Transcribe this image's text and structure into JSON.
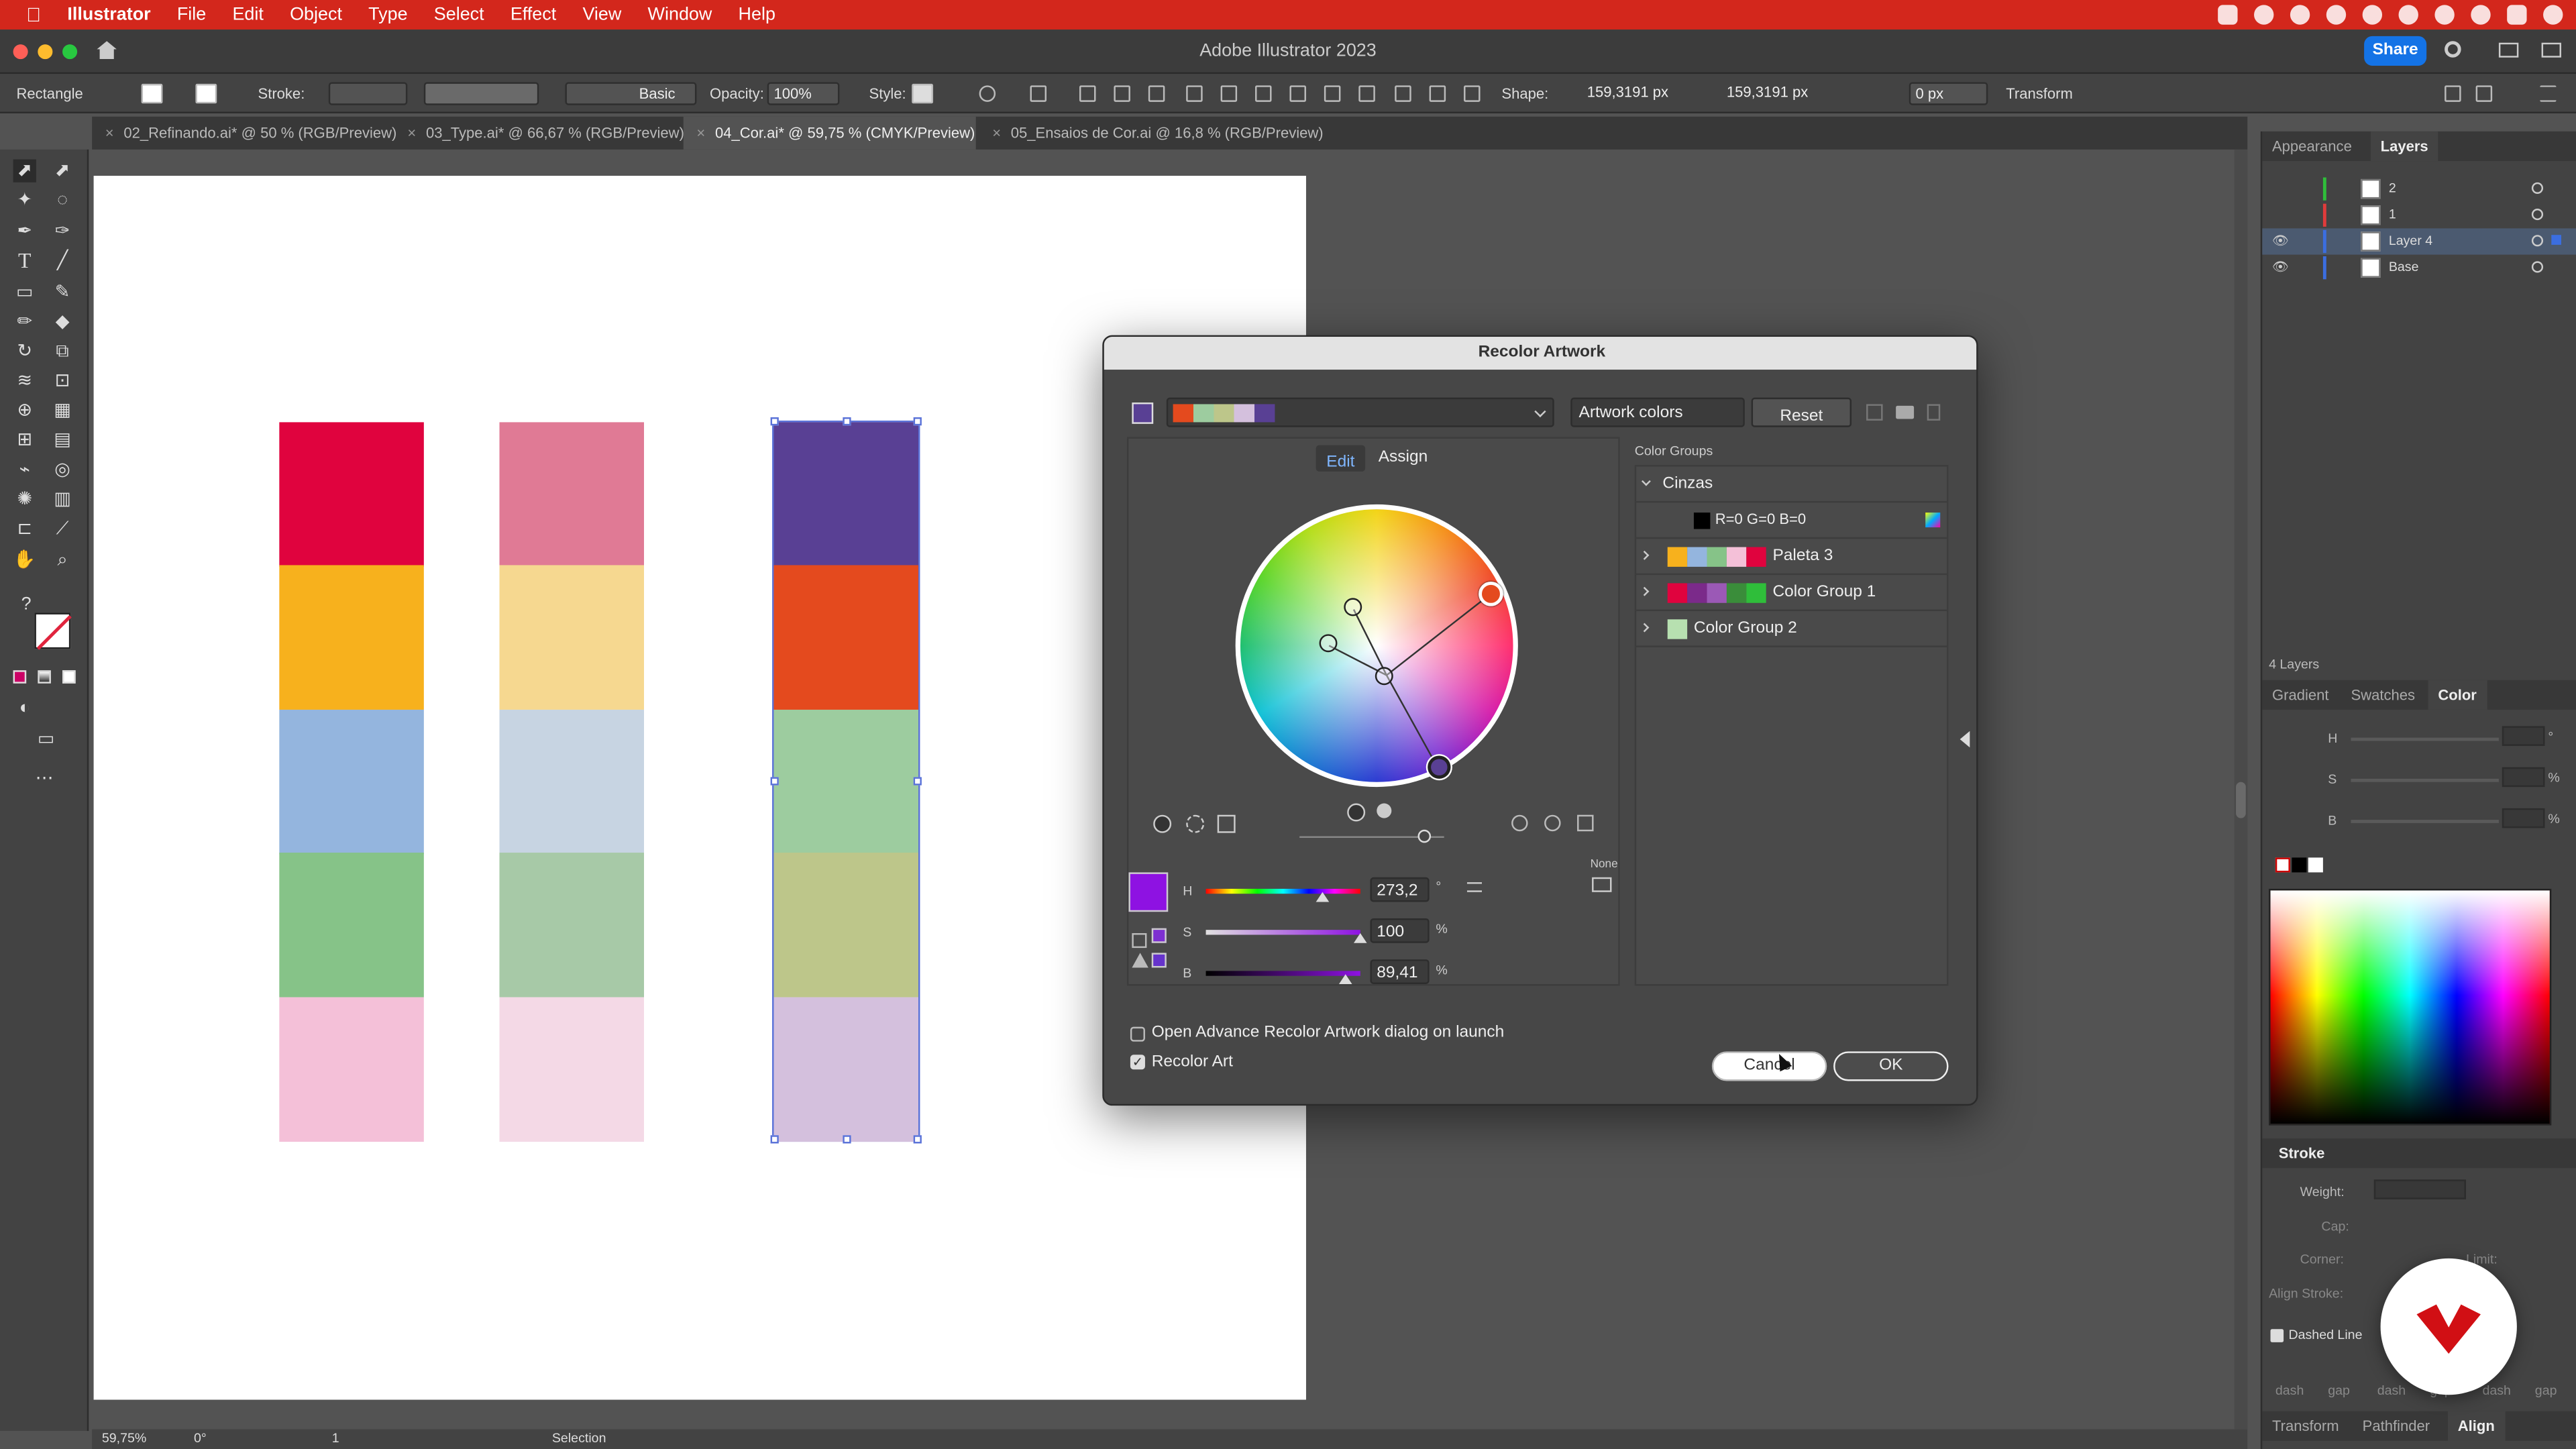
{
  "menubar": {
    "app": "Illustrator",
    "items": [
      "File",
      "Edit",
      "Object",
      "Type",
      "Select",
      "Effect",
      "View",
      "Window",
      "Help"
    ]
  },
  "window": {
    "title": "Adobe Illustrator 2023",
    "share": "Share"
  },
  "controlbar": {
    "selection": "Rectangle",
    "stroke_label": "Stroke:",
    "brush": "Basic",
    "opacity_label": "Opacity:",
    "opacity": "100%",
    "style_label": "Style:",
    "shape_label": "Shape:",
    "width": "159,3191 px",
    "height": "159,3191 px",
    "corner": "0 px",
    "transform": "Transform"
  },
  "tabs": [
    {
      "label": "02_Refinando.ai* @ 50 % (RGB/Preview)"
    },
    {
      "label": "03_Type.ai* @ 66,67 % (RGB/Preview)"
    },
    {
      "label": "04_Cor.ai* @ 59,75 % (CMYK/Preview)",
      "active": true
    },
    {
      "label": "05_Ensaios de Cor.ai @ 16,8 % (RGB/Preview)"
    }
  ],
  "artwork": {
    "columns": [
      {
        "colors": [
          "#e0033e",
          "#f7b11d",
          "#94b5de",
          "#86c388",
          "#f4c0d8"
        ]
      },
      {
        "colors": [
          "#e07a95",
          "#f6d890",
          "#c7d4e2",
          "#a7c9a7",
          "#f4d9e6"
        ]
      },
      {
        "colors": [
          "#594094",
          "#e44a1e",
          "#9dcc9f",
          "#bdc68a",
          "#d4c0dd"
        ],
        "selected": true
      }
    ]
  },
  "status": {
    "zoom": "59,75%",
    "rotation": "0°",
    "artboard": "1",
    "tool": "Selection"
  },
  "layers_panel": {
    "tabs": [
      "Appearance",
      "Layers"
    ],
    "layers": [
      {
        "name": "2",
        "color": "#2fbe3a",
        "visible": false
      },
      {
        "name": "1",
        "color": "#e03b3b",
        "visible": false
      },
      {
        "name": "Layer 4",
        "color": "#3b6ee0",
        "visible": true,
        "selected": true
      },
      {
        "name": "Base",
        "color": "#3b6ee0",
        "visible": true
      }
    ],
    "count": "4 Layers"
  },
  "color_panel": {
    "tabs": [
      "Gradient",
      "Swatches",
      "Color"
    ],
    "h": "H",
    "s": "S",
    "b": "B",
    "pct": "%",
    "deg": "°"
  },
  "stroke_panel": {
    "title": "Stroke",
    "weight": "Weight:",
    "cap": "Cap:",
    "corner": "Corner:",
    "limit": "Limit:",
    "align": "Align Stroke:",
    "dashed": "Dashed Line",
    "dash_labels": [
      "dash",
      "gap",
      "dash",
      "gap",
      "dash",
      "gap"
    ]
  },
  "bottom_tabs": [
    "Transform",
    "Pathfinder",
    "Align"
  ],
  "dialog": {
    "title": "Recolor Artwork",
    "source": "Artwork colors",
    "reset": "Reset",
    "modes": [
      "Edit",
      "Assign"
    ],
    "groups_title": "Color Groups",
    "groups": [
      {
        "name": "Cinzas",
        "expanded": true,
        "children": [
          {
            "name": "R=0 G=0 B=0"
          }
        ]
      },
      {
        "name": "Paleta 3",
        "swatches": [
          "#f7b11d",
          "#94b5de",
          "#86c388",
          "#f4c0d8",
          "#e0033e"
        ]
      },
      {
        "name": "Color Group 1",
        "swatches": [
          "#e0033e",
          "#7b2a8a",
          "#9b59b6",
          "#3a8d3a",
          "#2fbe3a"
        ]
      },
      {
        "name": "Color Group 2",
        "swatches": [
          "#b7e0b0"
        ]
      }
    ],
    "hsb": {
      "h_label": "H",
      "h": "273,2",
      "h_unit": "°",
      "s_label": "S",
      "s": "100",
      "s_unit": "%",
      "b_label": "B",
      "b": "89,41",
      "b_unit": "%"
    },
    "none_label": "None",
    "advanced_label": "Open Advance Recolor Artwork dialog on launch",
    "recolor_label": "Recolor Art",
    "cancel": "Cancel",
    "ok": "OK",
    "active_color": "#8e12e2"
  }
}
